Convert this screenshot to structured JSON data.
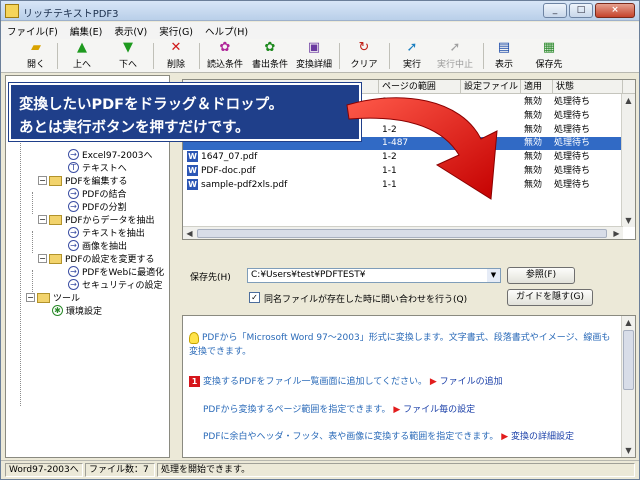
{
  "window": {
    "title": "リッチテキストPDF3",
    "buttons": [
      "_",
      "□",
      "×"
    ]
  },
  "menu": [
    "ファイル(F)",
    "編集(E)",
    "表示(V)",
    "実行(G)",
    "ヘルプ(H)"
  ],
  "toolbar": {
    "open": "開く",
    "up": "上へ",
    "down": "下へ",
    "delete": "削除",
    "read_cond": "読込条件",
    "write_cond": "書出条件",
    "convert_detail": "変換詳細",
    "clear": "クリア",
    "run": "実行",
    "stop": "実行中止",
    "view": "表示",
    "save_to": "保存先"
  },
  "tree": [
    {
      "label": "Excel97-2003へ",
      "kind": "item"
    },
    {
      "label": "テキストへ",
      "kind": "item"
    },
    {
      "label": "PDFを編集する",
      "kind": "folder"
    },
    {
      "label": "PDFの結合",
      "kind": "item"
    },
    {
      "label": "PDFの分割",
      "kind": "item"
    },
    {
      "label": "PDFからデータを抽出",
      "kind": "folder"
    },
    {
      "label": "テキストを抽出",
      "kind": "item"
    },
    {
      "label": "画像を抽出",
      "kind": "item"
    },
    {
      "label": "PDFの設定を変更する",
      "kind": "folder"
    },
    {
      "label": "PDFをWebに最適化",
      "kind": "item"
    },
    {
      "label": "セキュリティの設定",
      "kind": "item"
    },
    {
      "label": "ツール",
      "kind": "folder"
    },
    {
      "label": "環境設定",
      "kind": "tool"
    }
  ],
  "list": {
    "headers": [
      "ページの範囲",
      "設定ファイル",
      "適用",
      "状態"
    ],
    "rows": [
      {
        "name": "",
        "range": "1-2",
        "apply": "無効",
        "status": "処理待ち"
      },
      {
        "name": "",
        "range": "1-2",
        "apply": "無効",
        "status": "処理待ち"
      },
      {
        "name": "",
        "range": "1-2",
        "apply": "無効",
        "status": "処理待ち"
      },
      {
        "name": "",
        "range": "1-487",
        "apply": "無効",
        "status": "処理待ち"
      },
      {
        "name": "1647_07.pdf",
        "range": "1-2",
        "apply": "無効",
        "status": "処理待ち"
      },
      {
        "name": "PDF-doc.pdf",
        "range": "1-1",
        "apply": "無効",
        "status": "処理待ち"
      },
      {
        "name": "sample-pdf2xls.pdf",
        "range": "1-1",
        "apply": "無効",
        "status": "処理待ち"
      }
    ]
  },
  "settings": {
    "save_label": "保存先(H)",
    "save_path": "C:¥Users¥test¥PDFTEST¥",
    "browse_button": "参照(F)",
    "overwrite_check": "同名ファイルが存在した時に問い合わせを行う(Q)",
    "guide_button": "ガイドを隠す(G)"
  },
  "help": {
    "intro": "PDFから「Microsoft Word 97～2003」形式に変換します。文字書式、段落書式やイメージ、線画も",
    "intro2": "変換できます。",
    "step1": "変換するPDFをファイル一覧画面に追加してください。",
    "step1_link": "ファイルの追加",
    "step2": "PDFから変換するページ範囲を指定できます。",
    "step2_link": "ファイル毎の設定",
    "step3": "PDFに余白やヘッダ・フッタ、表や画像に変換する範囲を指定できます。",
    "step3_link": "変換の詳細設定"
  },
  "status": {
    "mode": "Word97-2003へ",
    "count": "ファイル数：7",
    "message": "処理を開始できます。"
  },
  "callout": {
    "line1": "変換したいPDFをドラッグ＆ドロップ。",
    "line2": "あとは実行ボタンを押すだけです。"
  }
}
